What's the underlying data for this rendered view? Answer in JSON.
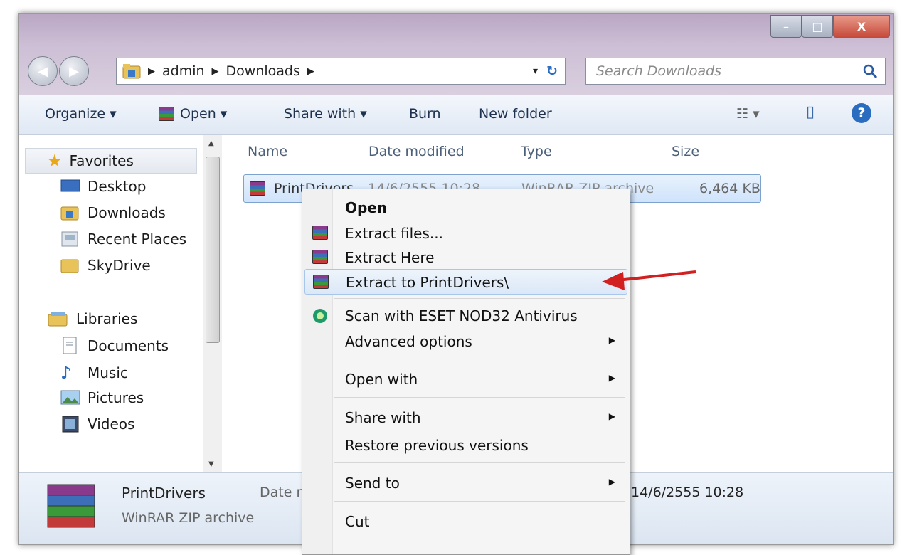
{
  "window": {
    "min": "–",
    "max": "□",
    "close": "X"
  },
  "nav": {
    "back": "◀",
    "forward": "▶"
  },
  "address": {
    "crumbs": [
      "admin",
      "Downloads"
    ],
    "dropdown": "▾",
    "refresh": "↻"
  },
  "search": {
    "placeholder": "Search Downloads",
    "icon": "search-icon"
  },
  "toolbar": {
    "organize": "Organize ▾",
    "open": "Open ▾",
    "share": "Share with ▾",
    "burn": "Burn",
    "new_folder": "New folder",
    "views": "☷ ▾",
    "preview": "▯",
    "help": "?"
  },
  "sidebar": {
    "favorites": "Favorites",
    "items": [
      "Desktop",
      "Downloads",
      "Recent Places",
      "SkyDrive"
    ],
    "libraries": "Libraries",
    "lib_items": [
      "Documents",
      "Music",
      "Pictures",
      "Videos"
    ]
  },
  "columns": [
    "Name",
    "Date modified",
    "Type",
    "Size"
  ],
  "file": {
    "name": "PrintDrivers",
    "date": "14/6/2555 10:28",
    "type": "WinRAR ZIP archive",
    "size": "6,464 KB"
  },
  "status": {
    "name": "PrintDrivers",
    "type": "WinRAR ZIP archive",
    "date_label": "Date m",
    "date_value": "14/6/2555 10:28"
  },
  "menu": {
    "open": "Open",
    "extract_files": "Extract files...",
    "extract_here": "Extract Here",
    "extract_to": "Extract to PrintDrivers\\",
    "scan": "Scan with ESET NOD32 Antivirus",
    "advanced": "Advanced options",
    "open_with": "Open with",
    "share_with": "Share with",
    "restore": "Restore previous versions",
    "send_to": "Send to",
    "cut": "Cut",
    "arrow": "▶"
  },
  "colors": {
    "annotation_arrow": "#d21f1f",
    "selection": "#cfe3fb"
  }
}
